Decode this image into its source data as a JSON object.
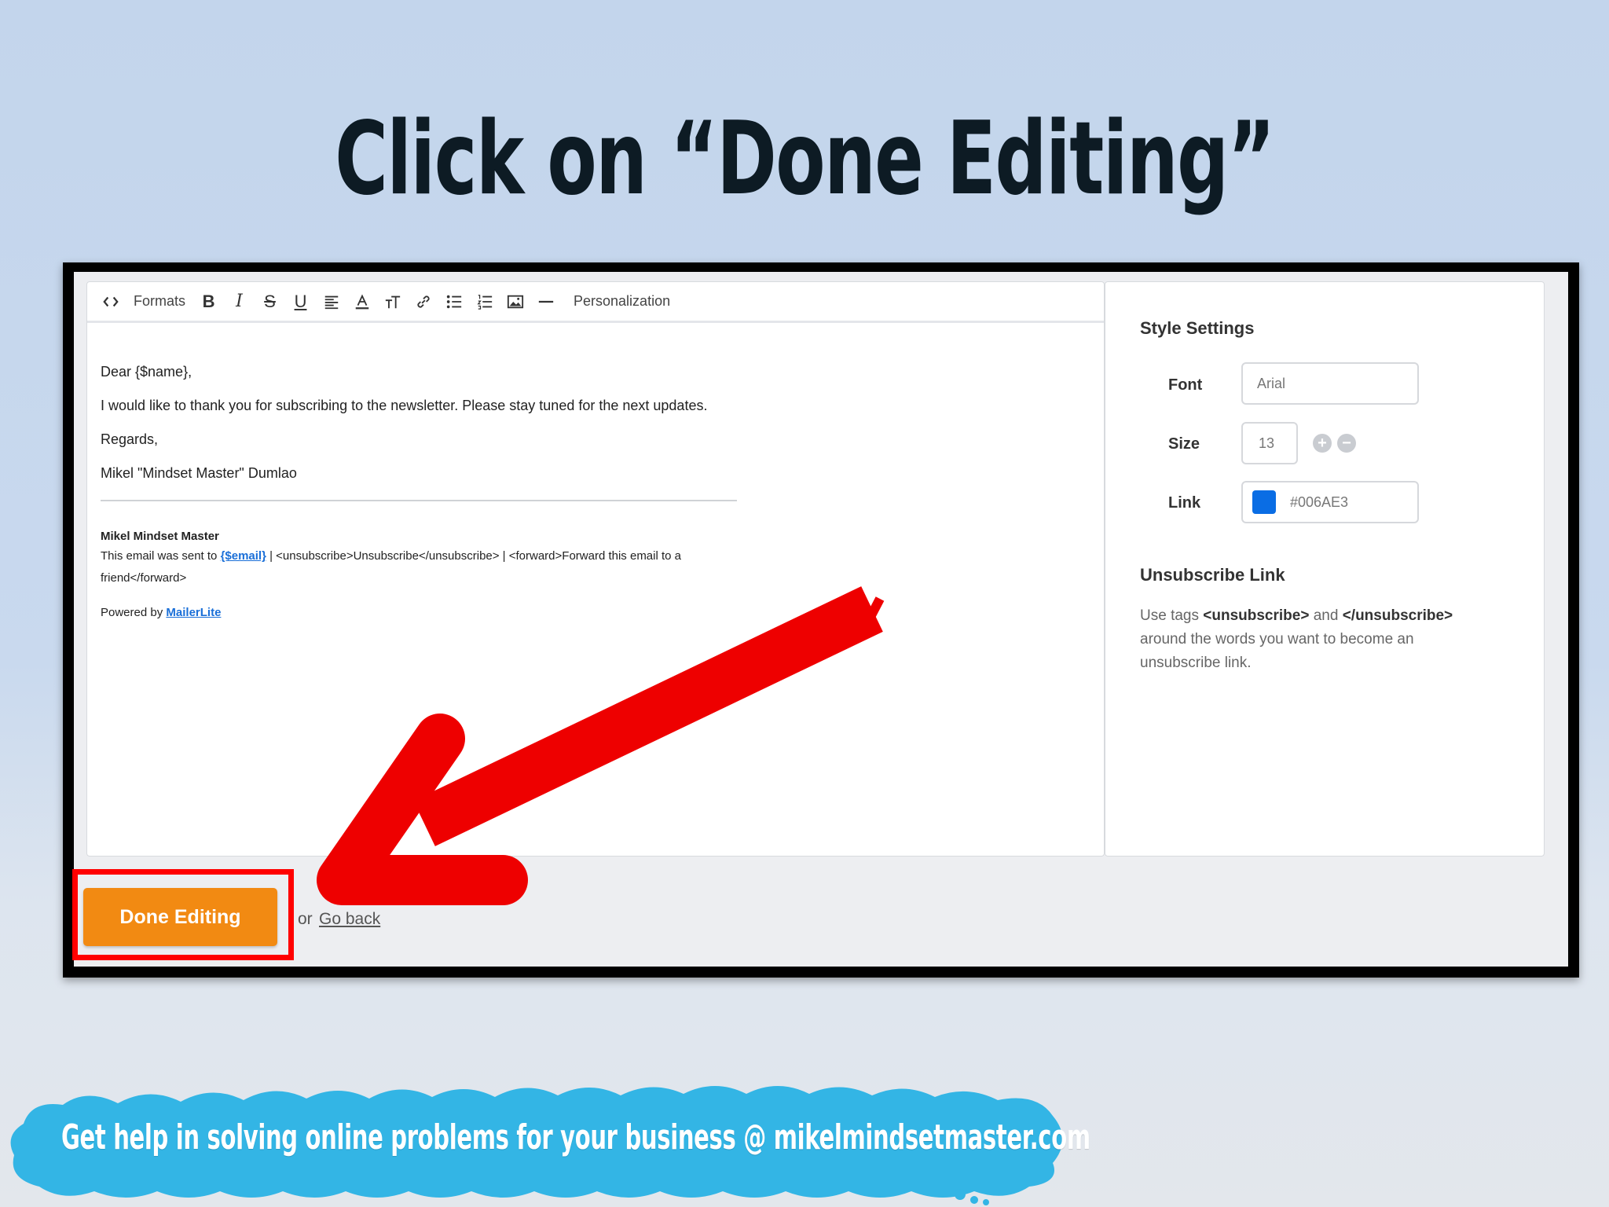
{
  "slide": {
    "title": "Click on “Done Editing”",
    "footer_banner": "Get help in solving online problems for your business @ mikelmindsetmaster.com"
  },
  "toolbar": {
    "formats_label": "Formats",
    "personalization_label": "Personalization",
    "icons": [
      "code-icon",
      "bold-icon",
      "italic-icon",
      "strikethrough-icon",
      "underline-icon",
      "align-icon",
      "text-color-icon",
      "text-size-icon",
      "link-icon",
      "bulleted-list-icon",
      "numbered-list-icon",
      "image-icon",
      "horizontal-rule-icon"
    ]
  },
  "email": {
    "greeting": "Dear {$name},",
    "body": "I would like to thank you for subscribing to the newsletter. Please stay tuned for the next updates.",
    "regards": "Regards,",
    "signature": "Mikel \"Mindset Master\" Dumlao",
    "footer_name": "Mikel Mindset Master",
    "footer_sent_prefix": "This email was sent to",
    "footer_email_link": "{$email}",
    "footer_sent_suffix": "| <unsubscribe>Unsubscribe</unsubscribe> | <forward>Forward this email to a friend</forward>",
    "powered_prefix": "Powered by",
    "powered_link": "MailerLite"
  },
  "style_settings": {
    "title": "Style Settings",
    "font_label": "Font",
    "font_value": "Arial",
    "size_label": "Size",
    "size_value": "13",
    "link_label": "Link",
    "link_color": "#006AE3",
    "link_swatch_color": "#0a6de4"
  },
  "unsubscribe": {
    "title": "Unsubscribe Link",
    "text_prefix": "Use tags",
    "tag_open": "<unsubscribe>",
    "text_and": "and",
    "tag_close": "</unsubscribe>",
    "text_suffix": "around the words you want to become an unsubscribe link."
  },
  "actions": {
    "done_label": "Done Editing",
    "or_label": "or",
    "go_back_label": "Go back"
  },
  "colors": {
    "accent_orange": "#f28a12",
    "highlight_red": "#ff0000",
    "link_blue": "#1a6fd8"
  }
}
